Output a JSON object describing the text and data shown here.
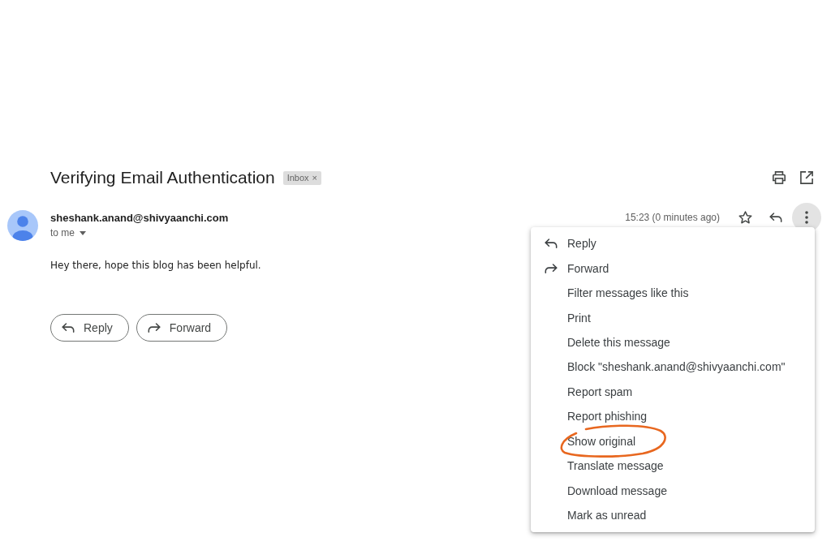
{
  "subject_bar": {
    "subject": "Verifying Email Authentication",
    "label": {
      "text": "Inbox",
      "remove": "×"
    }
  },
  "message": {
    "sender": "sheshank.anand@shivyaanchi.com",
    "recipient": "to me",
    "time": "15:23 (0 minutes ago)",
    "starred": false,
    "body": "Hey there, hope this blog has been helpful.",
    "actions": [
      {
        "label": "Reply",
        "kind": "reply"
      },
      {
        "label": "Forward",
        "kind": "forward"
      }
    ]
  },
  "more_menu": {
    "open": true,
    "items": [
      {
        "label": "Reply",
        "kind": "reply",
        "circled": false
      },
      {
        "label": "Forward",
        "kind": "forward",
        "circled": false
      },
      {
        "label": "Filter messages like this",
        "kind": "plain",
        "circled": false
      },
      {
        "label": "Print",
        "kind": "plain",
        "circled": false
      },
      {
        "label": "Delete this message",
        "kind": "plain",
        "circled": false
      },
      {
        "label": "Block \"sheshank.anand@shivyaanchi.com\"",
        "kind": "plain",
        "circled": false
      },
      {
        "label": "Report spam",
        "kind": "plain",
        "circled": false
      },
      {
        "label": "Report phishing",
        "kind": "plain",
        "circled": false
      },
      {
        "label": "Show original",
        "kind": "plain",
        "circled": true
      },
      {
        "label": "Translate message",
        "kind": "plain",
        "circled": false
      },
      {
        "label": "Download message",
        "kind": "plain",
        "circled": false
      },
      {
        "label": "Mark as unread",
        "kind": "plain",
        "circled": false
      }
    ]
  }
}
